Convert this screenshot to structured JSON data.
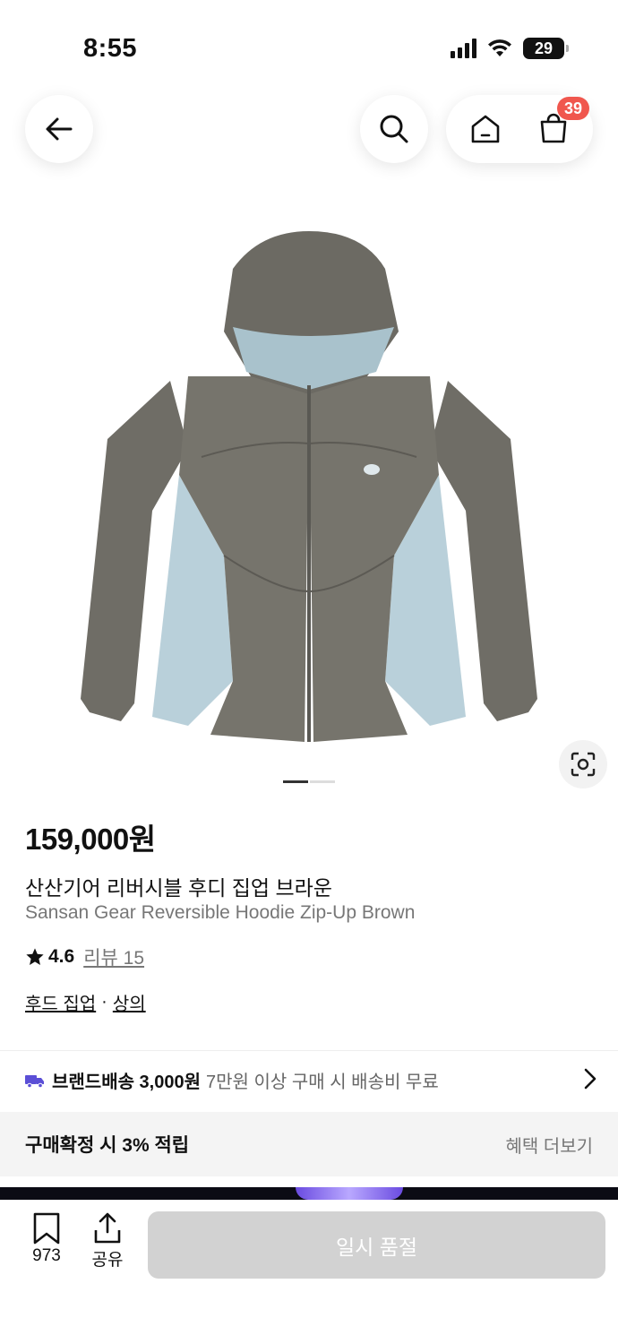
{
  "status_bar": {
    "time": "8:55",
    "battery": "29"
  },
  "header": {
    "cart_count": "39"
  },
  "product": {
    "price": "159,000원",
    "name_ko": "산산기어 리버시블 후디 집업 브라운",
    "name_en": "Sansan Gear Reversible Hoodie Zip-Up Brown",
    "rating": "4.6",
    "review_label": "리뷰 15",
    "category_primary": "후드 집업",
    "category_separator": "·",
    "category_secondary": "상의",
    "image_count": 2,
    "image_index": 1
  },
  "shipping": {
    "strong": "브랜드배송 3,000원",
    "sub": "7만원 이상 구매 시 배송비 무료"
  },
  "benefit": {
    "text": "구매확정 시 3% 적립",
    "more": "혜택 더보기"
  },
  "bottom_bar": {
    "bookmark_count": "973",
    "share_label": "공유",
    "purchase_label": "일시 품절"
  },
  "colors": {
    "badge": "#f0574e",
    "truck": "#5b4fd6",
    "disabled_button": "#d2d2d2"
  }
}
